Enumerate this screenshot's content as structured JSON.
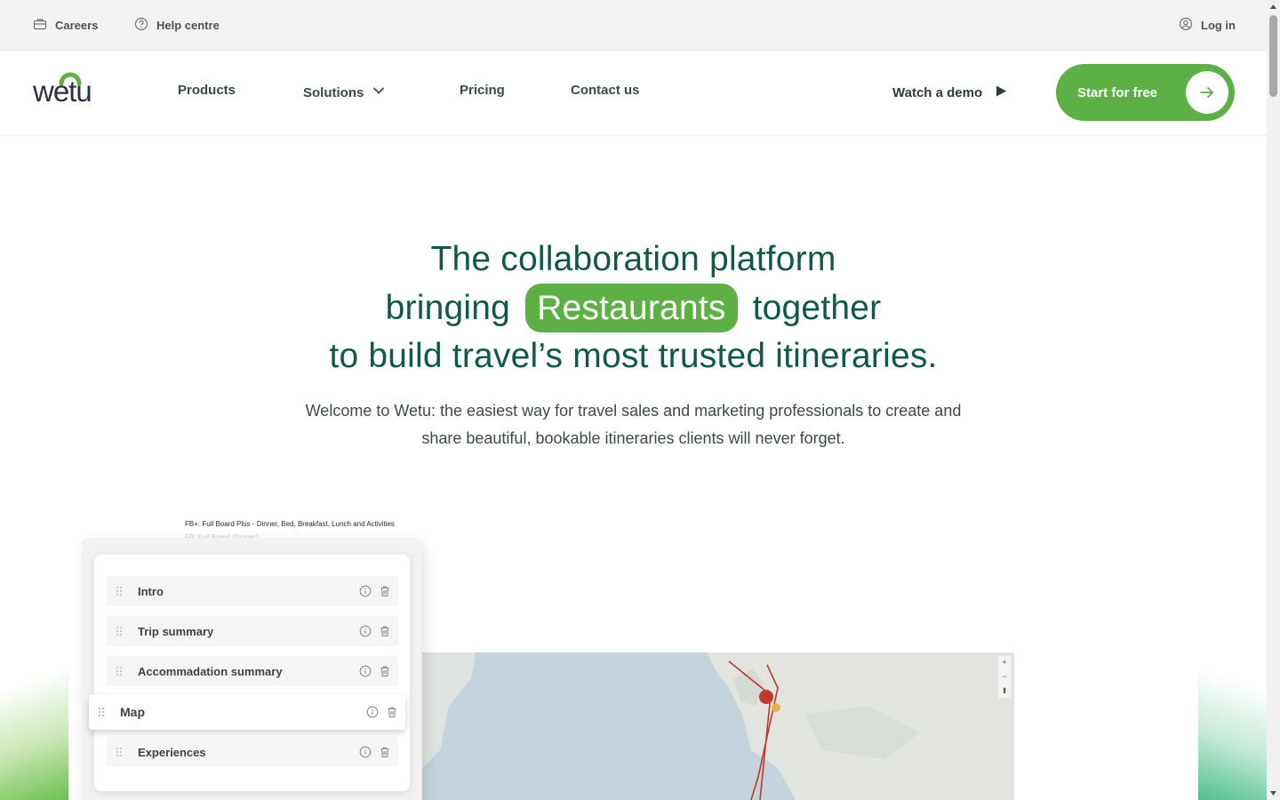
{
  "utility_bar": {
    "careers": "Careers",
    "help_centre": "Help centre",
    "log_in": "Log in"
  },
  "nav": {
    "logo_text": "wetu",
    "links": [
      "Products",
      "Solutions",
      "Pricing",
      "Contact us"
    ],
    "watch_demo": "Watch a demo",
    "cta": "Start for free"
  },
  "hero": {
    "line1": "The collaboration platform",
    "line2_before": "bringing",
    "highlight": "Restaurants",
    "line2_after": "together",
    "line3": "to build travel’s most trusted itineraries.",
    "subtitle": "Welcome to Wetu: the easiest way for travel sales and marketing professionals to create and share beautiful, bookable itineraries clients will never forget."
  },
  "showcase": {
    "note": "FB+: Full Board Plus - Dinner, Bed, Breakfast, Lunch and Activities",
    "note_faded": "FB: Full Board (Dinner)",
    "sections": [
      "Intro",
      "Trip summary",
      "Accommadation summary",
      "Map",
      "Experiences"
    ],
    "map_controls": [
      "+",
      "−",
      "⬆"
    ]
  },
  "colors": {
    "brand_green": "#5db043",
    "heading_teal": "#0e5a49"
  }
}
